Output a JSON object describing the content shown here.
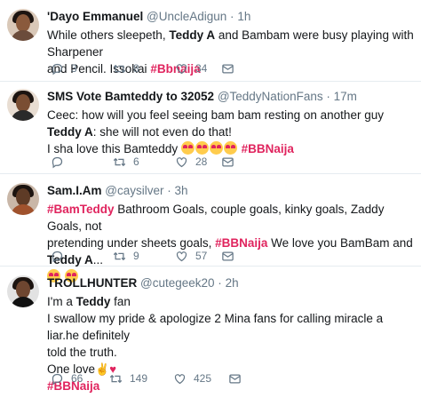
{
  "tweets": [
    {
      "name": "'Dayo Emmanuel",
      "handle": "@UncleAdigun",
      "time": "1h",
      "lines": [
        [
          "While others sleepeth, ",
          "Teddy A",
          " and Bambam were busy playing with Sharpener"
        ],
        [
          "and Pencil. Issokai ",
          "#Bbnaija",
          ""
        ]
      ],
      "replies": "3",
      "retweets": "8",
      "likes": "34"
    },
    {
      "name": "SMS Vote Bamteddy to 32052",
      "handle": "@TeddyNationFans",
      "time": "17m",
      "line1": "Ceec: how will you feel seeing bam bam resting on another guy",
      "line2_bold": "Teddy A",
      "line2_rest": ": she will not even do that!",
      "line3": "I sha love this Bamteddy",
      "line3_tag": "#BBNaija",
      "replies": "",
      "retweets": "6",
      "likes": "28"
    },
    {
      "name": "Sam.I.Am",
      "handle": "@caysilver",
      "time": "3h",
      "line1_tag": "#BamTeddy",
      "line1_rest": " Bathroom Goals, couple goals, kinky goals, Zaddy Goals, not",
      "line2_a": "pretending under sheets goals, ",
      "line2_tag": "#BBNaija",
      "line2_b": " We love you BamBam and ",
      "line2_bold": "Teddy A",
      "line2_c": "...",
      "replies": "",
      "retweets": "9",
      "likes": "57"
    },
    {
      "name": "TROLLHUNTER",
      "handle": "@cutegeek20",
      "time": "2h",
      "line1_a": "I'm a ",
      "line1_bold": "Teddy",
      "line1_b": " fan",
      "line2": "I swallow my pride & apologize 2 Mina fans for calling miracle a liar.he definitely",
      "line3": "told the truth.",
      "line4": "One love",
      "line5_tag": "#BBNaija",
      "replies": "66",
      "retweets": "149",
      "likes": "425"
    }
  ],
  "colors": {
    "hashtag": "#e0245e",
    "muted": "#657786",
    "divider": "#e6ecf0"
  },
  "icons": {
    "reply": "reply-icon",
    "retweet": "retweet-icon",
    "like": "heart-outline-icon",
    "message": "direct-message-icon"
  }
}
